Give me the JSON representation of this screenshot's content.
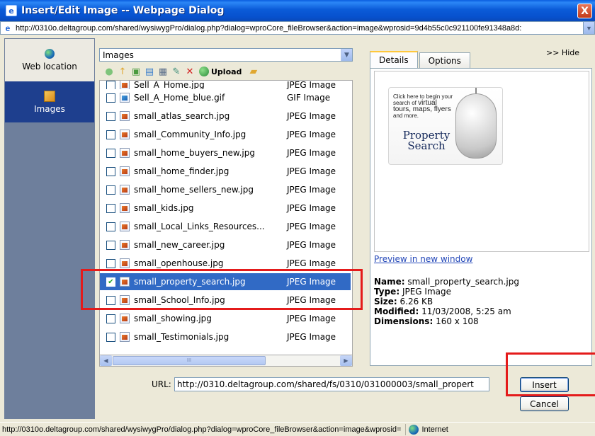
{
  "window": {
    "title": "Insert/Edit Image -- Webpage Dialog",
    "close_label": "X"
  },
  "address_bar": {
    "url": "http://0310o.deltagroup.com/shared/wysiwygPro/dialog.php?dialog=wproCore_fileBrowser&action=image&wprosid=9d4b55c0c921100fe91348a8d:"
  },
  "left_nav": {
    "items": [
      {
        "label": "Web location",
        "icon": "globe-icon"
      },
      {
        "label": "Images",
        "icon": "images-icon",
        "selected": true
      }
    ]
  },
  "folder_select": {
    "value": "Images"
  },
  "toolbar": {
    "upload_label": "Upload"
  },
  "file_list": {
    "items": [
      {
        "name": "Sell_A_Home.jpg",
        "type": "JPEG Image",
        "checked": false
      },
      {
        "name": "Sell_A_Home_blue.gif",
        "type": "GIF Image",
        "checked": false
      },
      {
        "name": "small_atlas_search.jpg",
        "type": "JPEG Image",
        "checked": false
      },
      {
        "name": "small_Community_Info.jpg",
        "type": "JPEG Image",
        "checked": false
      },
      {
        "name": "small_home_buyers_new.jpg",
        "type": "JPEG Image",
        "checked": false
      },
      {
        "name": "small_home_finder.jpg",
        "type": "JPEG Image",
        "checked": false
      },
      {
        "name": "small_home_sellers_new.jpg",
        "type": "JPEG Image",
        "checked": false
      },
      {
        "name": "small_kids.jpg",
        "type": "JPEG Image",
        "checked": false
      },
      {
        "name": "small_Local_Links_Resources...",
        "type": "JPEG Image",
        "checked": false
      },
      {
        "name": "small_new_career.jpg",
        "type": "JPEG Image",
        "checked": false
      },
      {
        "name": "small_openhouse.jpg",
        "type": "JPEG Image",
        "checked": false
      },
      {
        "name": "small_property_search.jpg",
        "type": "JPEG Image",
        "checked": true,
        "selected": true
      },
      {
        "name": "small_School_Info.jpg",
        "type": "JPEG Image",
        "checked": false
      },
      {
        "name": "small_showing.jpg",
        "type": "JPEG Image",
        "checked": false
      },
      {
        "name": "small_Testimonials.jpg",
        "type": "JPEG Image",
        "checked": false
      }
    ]
  },
  "right_pane": {
    "hide_label": ">> Hide",
    "tabs": [
      {
        "label": "Details",
        "active": true
      },
      {
        "label": "Options",
        "active": false
      }
    ],
    "preview_image_text": {
      "line1": "Click here to begin your",
      "line2": "search of",
      "line2_em": "virtual",
      "line3": "tours, maps, flyers",
      "line4": "and more.",
      "headline1": "Property",
      "headline2": "Search"
    },
    "preview_link": "Preview in new window",
    "details": {
      "name_label": "Name:",
      "name_value": "small_property_search.jpg",
      "type_label": "Type:",
      "type_value": "JPEG Image",
      "size_label": "Size:",
      "size_value": "6.26 KB",
      "modified_label": "Modified:",
      "modified_value": "11/03/2008, 5:25 am",
      "dimensions_label": "Dimensions:",
      "dimensions_value": "160 x 108"
    }
  },
  "url_field": {
    "label": "URL:",
    "value": "http://0310.deltagroup.com/shared/fs/0310/031000003/small_propert"
  },
  "buttons": {
    "insert": "Insert",
    "cancel": "Cancel"
  },
  "status_bar": {
    "url": "http://0310o.deltagroup.com/shared/wysiwygPro/dialog.php?dialog=wproCore_fileBrowser&action=image&wprosid=",
    "zone": "Internet"
  },
  "colors": {
    "titlebar": "#0B5BD8",
    "selection": "#316AC5",
    "highlight": "#E41B1B",
    "nav_bg": "#6E7F9C",
    "nav_selected": "#1E3F8E"
  }
}
